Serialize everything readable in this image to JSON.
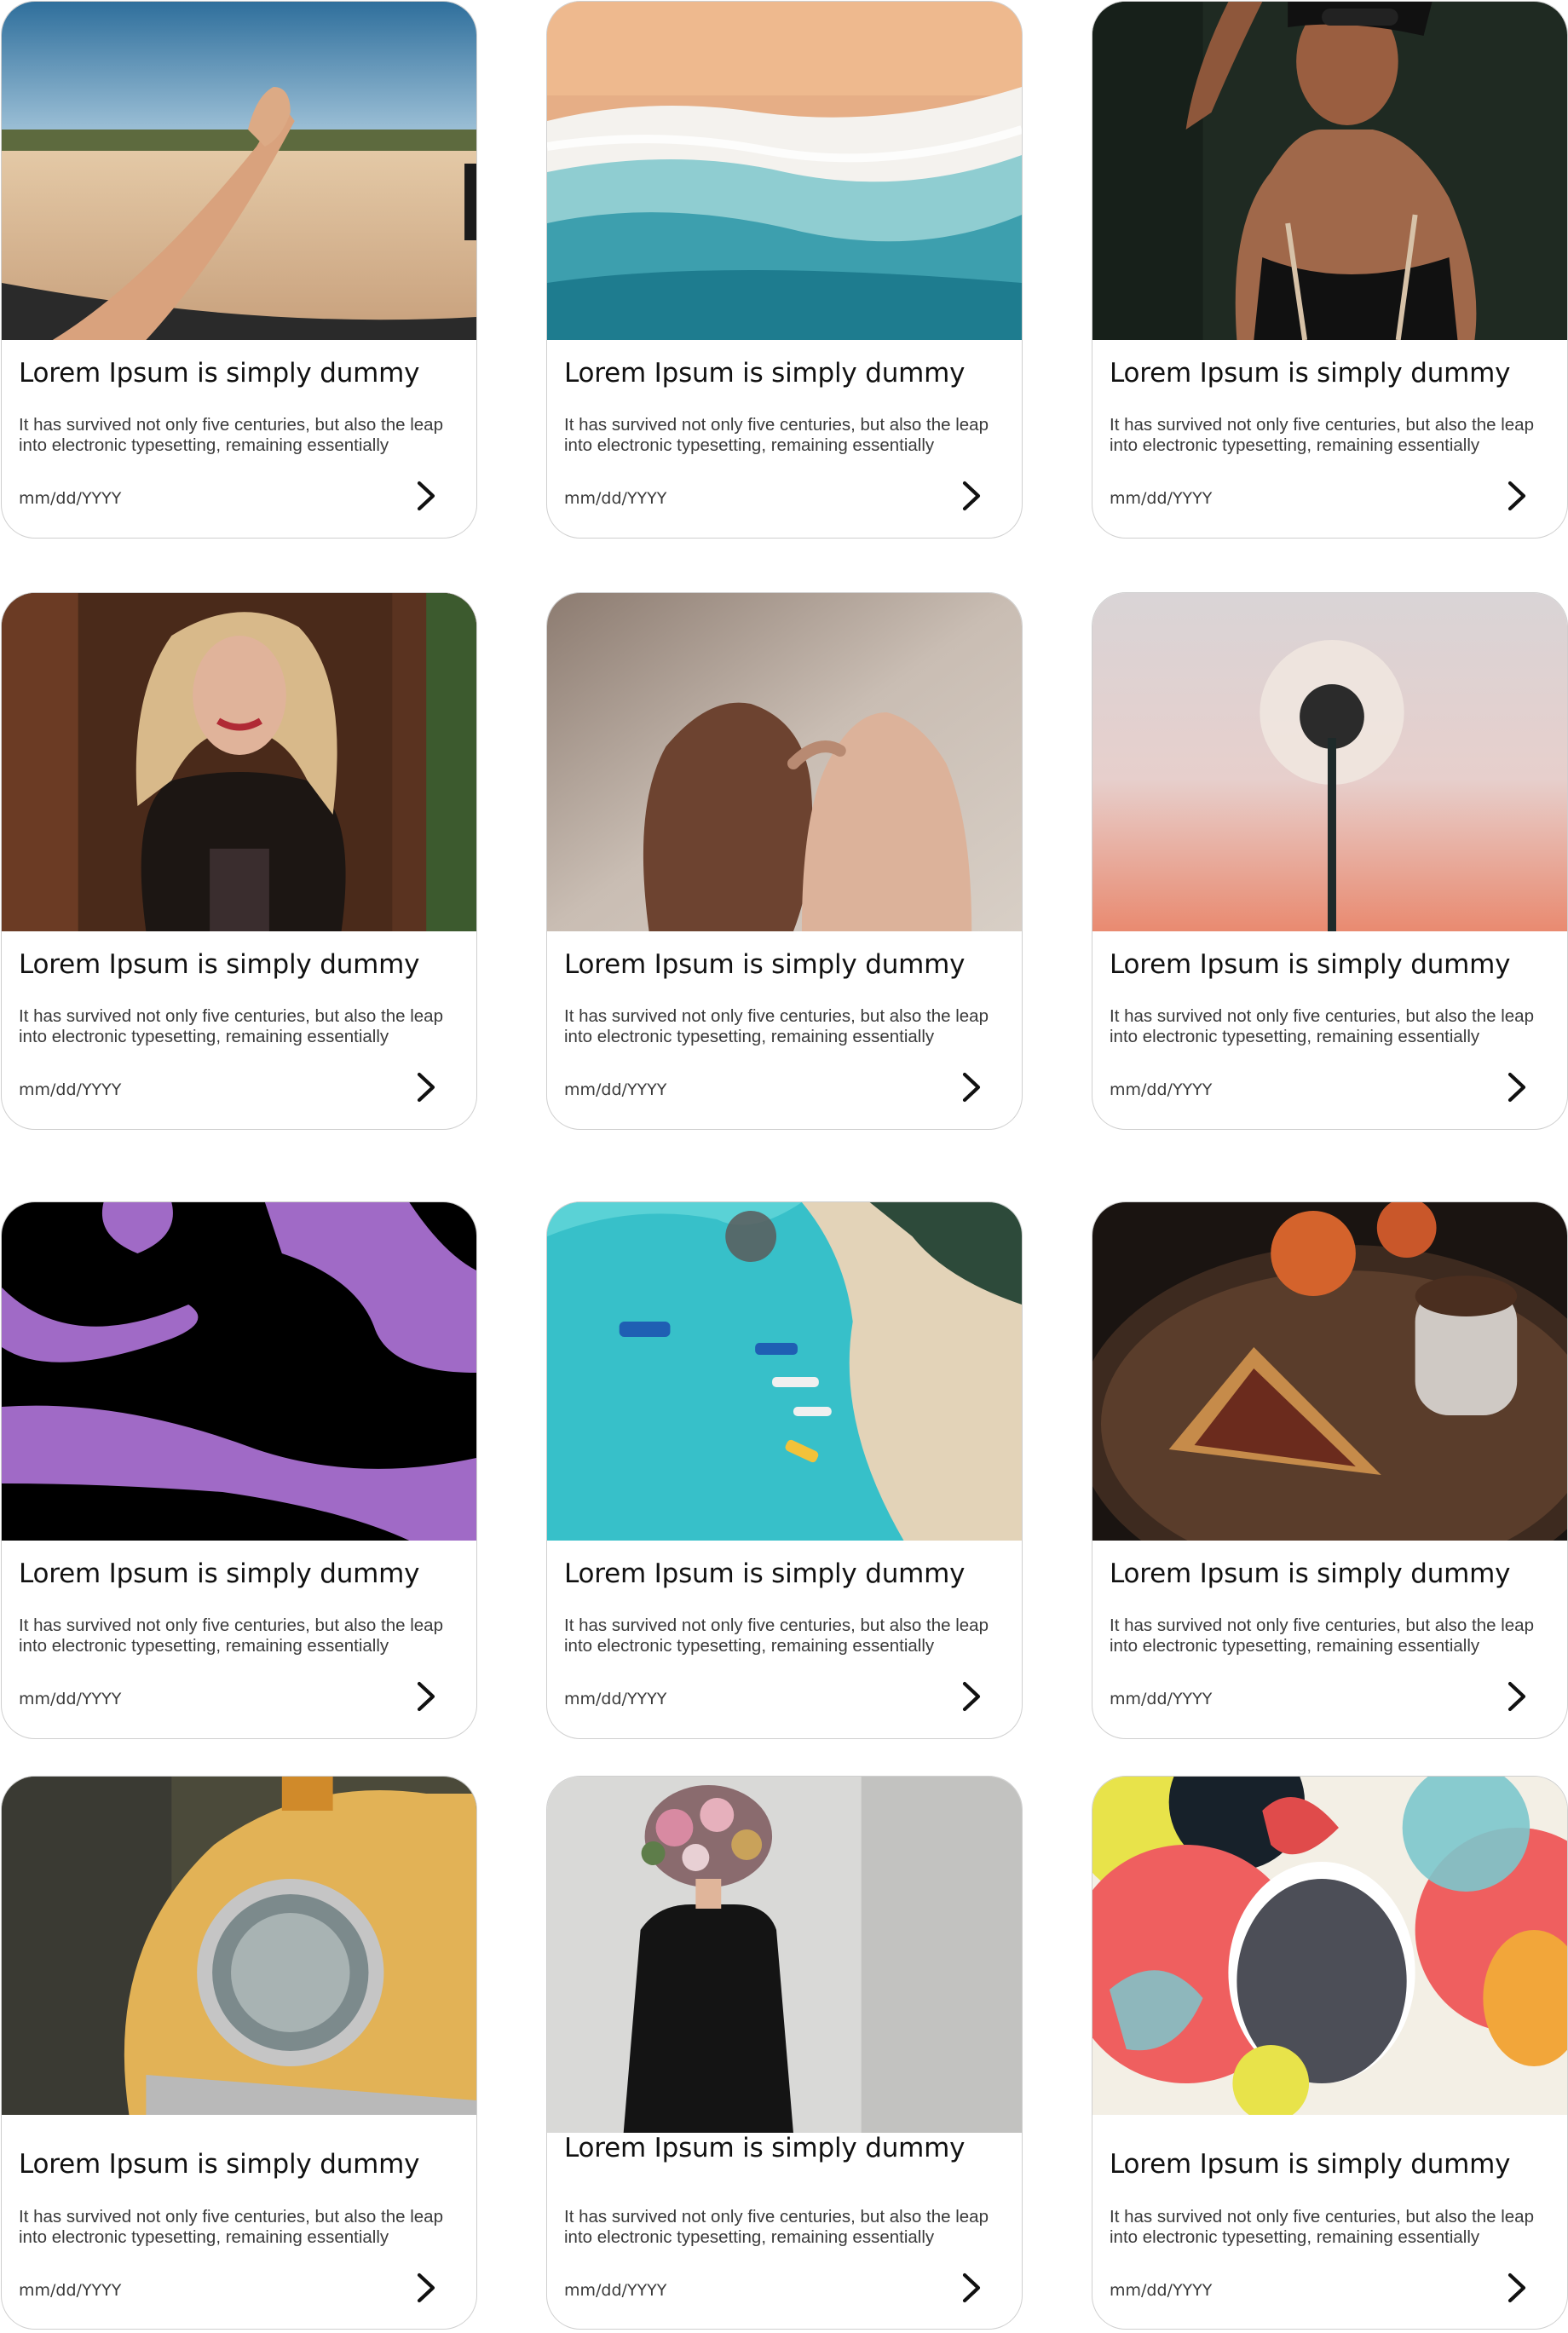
{
  "cards": [
    {
      "title": "Lorem Ipsum is simply dummy",
      "description": "It has survived not only five centuries, but also the leap into electronic typesetting, remaining essentially",
      "date": "mm/dd/YYYY",
      "image": "arm-out-car-window-beach",
      "action_icon": "chevron-right-icon"
    },
    {
      "title": "Lorem Ipsum is simply dummy",
      "description": "It has survived not only five centuries, but also the leap into electronic typesetting, remaining essentially",
      "date": "mm/dd/YYYY",
      "image": "aerial-beach-waves",
      "action_icon": "chevron-right-icon"
    },
    {
      "title": "Lorem Ipsum is simply dummy",
      "description": "It has survived not only five centuries, but also the leap into electronic typesetting, remaining essentially",
      "date": "mm/dd/YYYY",
      "image": "woman-sunglasses-portrait",
      "action_icon": "chevron-right-icon"
    },
    {
      "title": "Lorem Ipsum is simply dummy",
      "description": "It has survived not only five centuries, but also the leap into electronic typesetting, remaining essentially",
      "date": "mm/dd/YYYY",
      "image": "blonde-woman-doorway",
      "action_icon": "chevron-right-icon"
    },
    {
      "title": "Lorem Ipsum is simply dummy",
      "description": "It has survived not only five centuries, but also the leap into electronic typesetting, remaining essentially",
      "date": "mm/dd/YYYY",
      "image": "pinky-promise-hands",
      "action_icon": "chevron-right-icon"
    },
    {
      "title": "Lorem Ipsum is simply dummy",
      "description": "It has survived not only five centuries, but also the leap into electronic typesetting, remaining essentially",
      "date": "mm/dd/YYYY",
      "image": "dandelion-sunset",
      "action_icon": "chevron-right-icon"
    },
    {
      "title": "Lorem Ipsum is simply dummy",
      "description": "It has survived not only five centuries, but also the leap into electronic typesetting, remaining essentially",
      "date": "mm/dd/YYYY",
      "image": "purple-black-abstract",
      "action_icon": "chevron-right-icon"
    },
    {
      "title": "Lorem Ipsum is simply dummy",
      "description": "It has survived not only five centuries, but also the leap into electronic typesetting, remaining essentially",
      "date": "mm/dd/YYYY",
      "image": "aerial-boats-lagoon",
      "action_icon": "chevron-right-icon"
    },
    {
      "title": "Lorem Ipsum is simply dummy",
      "description": "It has survived not only five centuries, but also the leap into electronic typesetting, remaining essentially",
      "date": "mm/dd/YYYY",
      "image": "pie-and-coffee",
      "action_icon": "chevron-right-icon"
    },
    {
      "title": "Lorem Ipsum is simply dummy",
      "description": "It has survived not only five centuries, but also the leap into electronic typesetting, remaining essentially",
      "date": "mm/dd/YYYY",
      "image": "yellow-car-headlight",
      "action_icon": "chevron-right-icon"
    },
    {
      "title": "Lorem Ipsum is simply dummy",
      "description": "It has survived not only five centuries, but also the leap into electronic typesetting, remaining essentially",
      "date": "mm/dd/YYYY",
      "image": "flower-head-person",
      "action_icon": "chevron-right-icon"
    },
    {
      "title": "Lorem Ipsum is simply dummy",
      "description": "It has survived not only five centuries, but also the leap into electronic typesetting, remaining essentially",
      "date": "mm/dd/YYYY",
      "image": "citrus-illustration",
      "action_icon": "chevron-right-icon"
    }
  ]
}
